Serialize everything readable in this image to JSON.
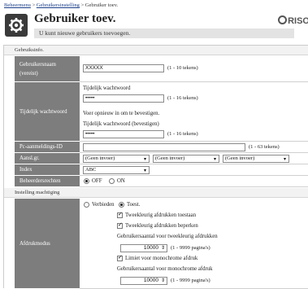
{
  "breadcrumb": {
    "item1": "Beheermenu",
    "sep1": ">",
    "item2": "Gebruikersinstelling",
    "sep2": ">",
    "current": "Gebruiker toev."
  },
  "header": {
    "title": "Gebruiker toev.",
    "subtitle": "U kunt nieuwe gebruikers toevoegen.",
    "brand": "RISO"
  },
  "sections": {
    "user_info": "Gebruiksinfo.",
    "privileges": "Instelling machtiging"
  },
  "username": {
    "label": "Gebruikersnaam",
    "required": "(vereist)",
    "value": "XXXXX",
    "hint": "(1 - 10 tekens)"
  },
  "temp_password": {
    "label": "Tijdelijk wachtwoord",
    "field_label": "Tijdelijk wachtwoord",
    "value": "•••••",
    "hint": "(1 - 16 tekens)",
    "confirm_note": "Voer opnieuw in om te bevestigen.",
    "confirm_label": "Tijdelijk wachtwoord (bevestigen)",
    "confirm_value": "•••••",
    "confirm_hint": "(1 - 16 tekens)"
  },
  "pc_login": {
    "label": "Pc-aanmeldings-ID",
    "value": "",
    "hint": "(1 - 63 tekens)"
  },
  "groups": {
    "label": "Aansl.gr.",
    "options": [
      "(Geen invoer)",
      "(Geen invoer)",
      "(Geen invoer)"
    ]
  },
  "index": {
    "label": "Index",
    "value": "ABC"
  },
  "admin_rights": {
    "label": "Beheerdersrechten",
    "off": "OFF",
    "on": "ON",
    "selected": "OFF"
  },
  "print_mode": {
    "label": "Afdrukmodus",
    "deny": "Verbieden",
    "allow": "Toest.",
    "selected": "Toest.",
    "color_allow": "Tweekleurig afdrukken toestaan",
    "color_limit": "Tweekleurig afdrukken beperken",
    "color_count_label": "Gebruikersaantal voor tweekleurig afdrukken",
    "color_count_value": "10000",
    "color_count_hint": "(1 - 9999 pagina's)",
    "mono_limit": "Limiet voor monochrome afdruk",
    "mono_count_label": "Gebruikersaantal voor monochrome afdruk",
    "mono_count_value": "10000",
    "mono_count_hint": "(1 - 9999 pagina's)"
  },
  "icons": {
    "header": "user-settings-icon",
    "spinner": "spinner-arrows-icon",
    "dropdown": "chevron-down-icon"
  }
}
